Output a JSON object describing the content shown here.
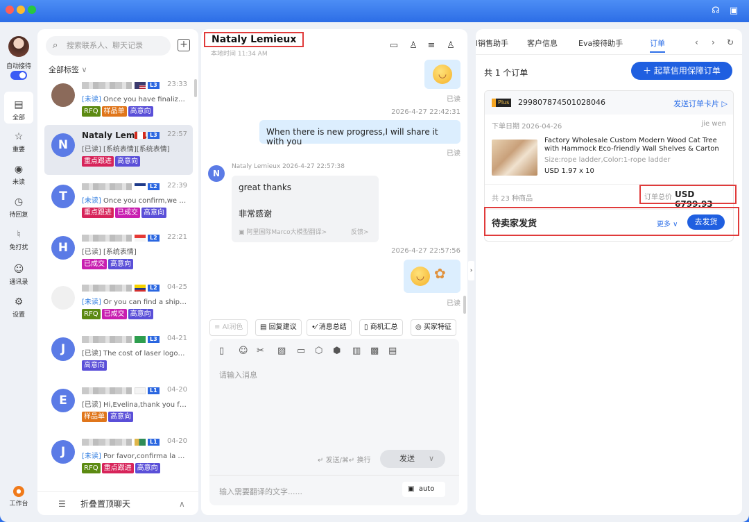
{
  "nav": {
    "auto_reception_label": "自动接待",
    "items": [
      {
        "label": "全部",
        "icon": "chat-icon"
      },
      {
        "label": "重要",
        "icon": "star-icon"
      },
      {
        "label": "未读",
        "icon": "eye-icon"
      },
      {
        "label": "待回复",
        "icon": "clock-icon"
      },
      {
        "label": "免打扰",
        "icon": "bell-off-icon"
      },
      {
        "label": "通讯录",
        "icon": "contact-icon"
      },
      {
        "label": "设置",
        "icon": "gear-icon"
      }
    ],
    "workbench_label": "工作台"
  },
  "contacts": {
    "search_placeholder": "搜索联系人、聊天记录",
    "tag_filter": "全部标签",
    "fold_label": "折叠置顶聊天",
    "list": [
      {
        "initial": "",
        "name": "",
        "time": "23:33",
        "level": "L3",
        "unread": "[未读]",
        "msg": "Once you have finalize...",
        "tags": [
          "RFQ",
          "样品单",
          "高意向"
        ]
      },
      {
        "initial": "N",
        "name": "Nataly Lemi...",
        "time": "22:57",
        "level": "L3",
        "unread": "[已读]",
        "msg": "[系统表情][系统表情]",
        "tags": [
          "重点跟进",
          "高意向"
        ]
      },
      {
        "initial": "T",
        "name": "",
        "time": "22:39",
        "level": "L2",
        "unread": "[未读]",
        "msg": "Once you confirm,we w...",
        "tags": [
          "重点跟进",
          "已成交",
          "高意向"
        ]
      },
      {
        "initial": "H",
        "name": "",
        "time": "22:21",
        "level": "L2",
        "unread": "[已读]",
        "msg": "[系统表情]",
        "tags": [
          "已成交",
          "高意向"
        ]
      },
      {
        "initial": "",
        "name": "",
        "time": "04-25",
        "level": "L2",
        "unread": "[未读]",
        "msg": "Or you can find a shippi...",
        "tags": [
          "RFQ",
          "已成交",
          "高意向"
        ]
      },
      {
        "initial": "J",
        "name": "",
        "time": "04-21",
        "level": "L3",
        "unread": "[已读]",
        "msg": "The cost of laser logos i...",
        "tags": [
          "高意向"
        ]
      },
      {
        "initial": "E",
        "name": "",
        "time": "04-20",
        "level": "L1",
        "unread": "[已读]",
        "msg": "Hi,Evelina,thank you for...",
        "tags": [
          "样品单",
          "高意向"
        ]
      },
      {
        "initial": "J",
        "name": "",
        "time": "04-20",
        "level": "L1",
        "unread": "[未读]",
        "msg": "Por favor,confirma la d...",
        "tags": [
          "RFQ",
          "重点跟进",
          "高意向"
        ]
      }
    ],
    "tag_colors": {
      "RFQ": "#5c8a12",
      "样品单": "#e0761b",
      "高意向": "#5a4fd8",
      "重点跟进": "#d7245a",
      "已成交": "#c81fb0"
    }
  },
  "chat": {
    "title": "Nataly Lemieux",
    "local_time": "本地时间 11:34 AM",
    "read_label": "已读",
    "ts1": "2026-4-27 22:42:31",
    "msg_me": "When there is new progress,I will share it with you",
    "sender_line": "Nataly Lemieux 2026-4-27 22:57:38",
    "msg_other_en": "great thanks",
    "msg_other_zh": "非常感谢",
    "translate_note": "阿里国际Marco大模型翻译>",
    "feedback": "反馈>",
    "ts2": "2026-4-27 22:57:56",
    "quick_actions": [
      "AI润色",
      "回复建议",
      "消息总结",
      "商机汇总",
      "买家特征"
    ],
    "input_placeholder": "请输入消息",
    "send_hint": "↵ 发送/⌘↵ 换行",
    "send_label": "发送",
    "translate_placeholder": "输入需要翻译的文字......",
    "auto_label": "auto"
  },
  "right": {
    "tabs": [
      "l销售助手",
      "客户信息",
      "Eva接待助手",
      "订单"
    ],
    "order_count": "共 1 个订单",
    "new_order_btn": "＋ 起草信用保障订单",
    "order": {
      "plus": "Plus",
      "id": "299807874501028046",
      "send_card": "发送订单卡片 ▷",
      "date": "下单日期 2026-04-26",
      "seller": "jie wen",
      "product_title": "Factory Wholesale Custom Modern Wood Cat Tree with Hammock Eco-friendly Wall Shelves & Carton Packing ...",
      "spec": "Size:rope ladder,Color:1-rope ladder",
      "price": "USD 1.97 x 10",
      "item_count": "共 23 种商品",
      "total_label": "订单总价",
      "total_value": "USD 6799.93",
      "status": "待卖家发货",
      "more": "更多 ∨",
      "ship_btn": "去发货"
    }
  }
}
